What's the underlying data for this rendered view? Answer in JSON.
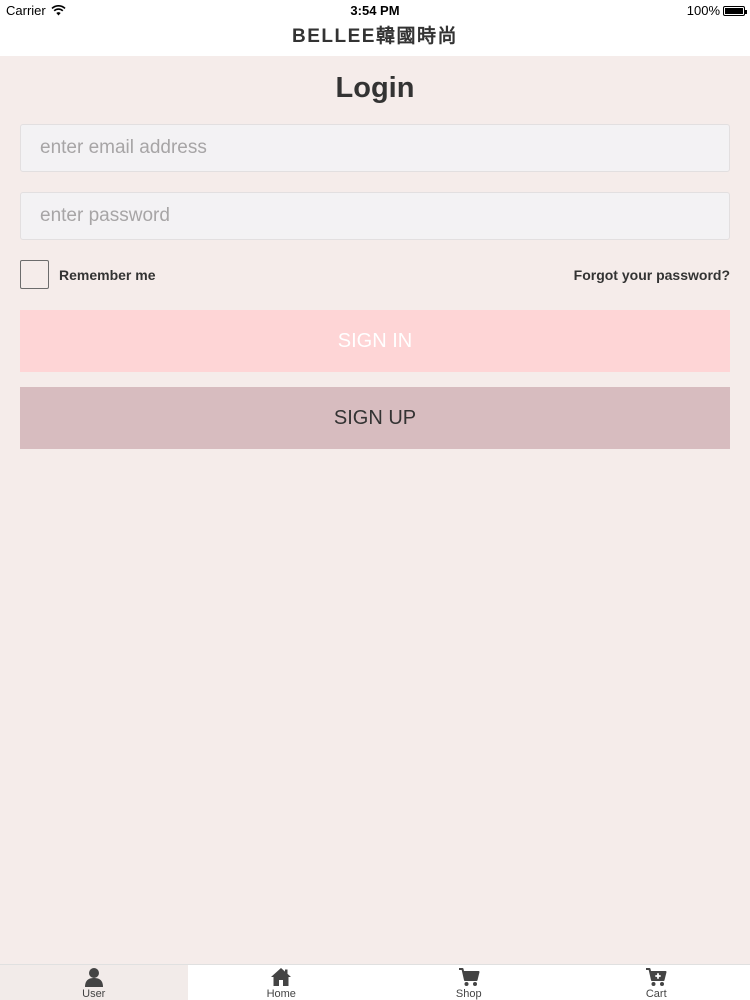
{
  "status_bar": {
    "carrier": "Carrier",
    "time": "3:54 PM",
    "battery": "100%"
  },
  "header": {
    "brand": "BELLEE韓國時尚"
  },
  "login": {
    "title": "Login",
    "email_placeholder": "enter email address",
    "password_placeholder": "enter password",
    "remember_label": "Remember me",
    "forgot_link": "Forgot your password?",
    "signin_label": "SIGN IN",
    "signup_label": "SIGN UP"
  },
  "tabs": [
    {
      "label": "User",
      "icon": "user-icon",
      "active": true
    },
    {
      "label": "Home",
      "icon": "home-icon",
      "active": false
    },
    {
      "label": "Shop",
      "icon": "shopping-cart-icon",
      "active": false
    },
    {
      "label": "Cart",
      "icon": "cart-add-icon",
      "active": false
    }
  ],
  "colors": {
    "background": "#f5ecea",
    "signin_button": "#fed5d6",
    "signup_button": "#d7bcbf"
  }
}
